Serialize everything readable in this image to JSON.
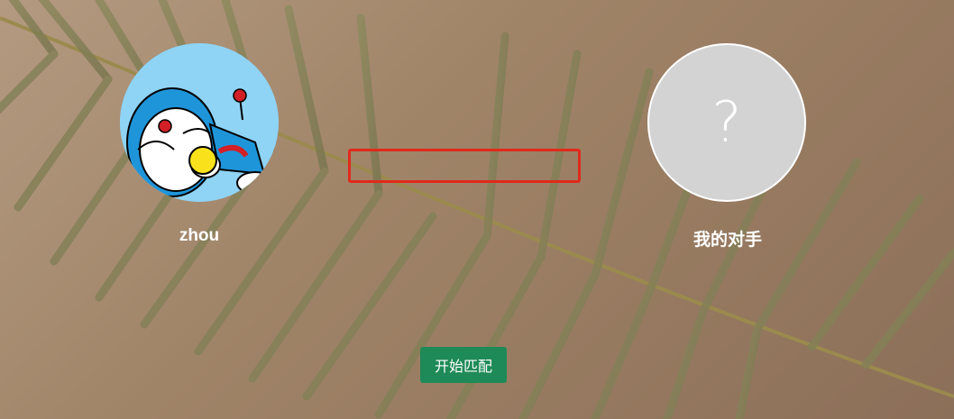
{
  "players": {
    "self": {
      "name": "zhou",
      "avatar_icon": "doraemon-avatar"
    },
    "opponent": {
      "name": "我的对手",
      "placeholder_symbol": "?"
    }
  },
  "match_status": "",
  "actions": {
    "start_match_label": "开始匹配"
  },
  "colors": {
    "start_button": "#1e8a57",
    "status_box_border": "#e02a1c",
    "opponent_avatar_bg": "#d3d3d3"
  }
}
